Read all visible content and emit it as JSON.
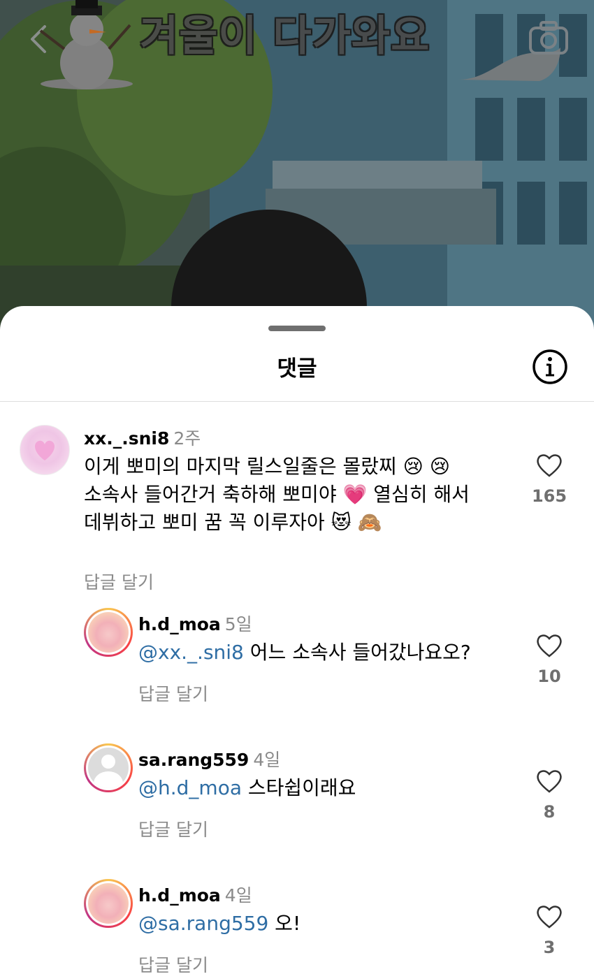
{
  "reel": {
    "overlay_text": "겨울이 다가와요",
    "icons": [
      "back-icon",
      "camera-icon",
      "snowman-sticker",
      "whale-sticker"
    ]
  },
  "sheet": {
    "title": "댓글",
    "info_icon": "info-icon"
  },
  "comments": [
    {
      "username": "xx._.sni8",
      "time": "2주",
      "lines": [
        "이게 뽀미의 마지막 릴스일줄은 몰랐찌 😢 😢",
        "소속사 들어간거 축하해 뽀미야 💗 열심히 해서",
        "데뷔하고 뽀미 꿈 꼭 이루자아 😻 🙈"
      ],
      "reply_label": "답글 달기",
      "likes": "165"
    },
    {
      "username": "h.d_moa",
      "time": "5일",
      "mention": "@xx._.sni8",
      "text": " 어느 소속사 들어갔나요오?",
      "reply_label": "답글 달기",
      "likes": "10"
    },
    {
      "username": "sa.rang559",
      "time": "4일",
      "mention": "@h.d_moa",
      "text": " 스타쉽이래요",
      "reply_label": "답글 달기",
      "likes": "8"
    },
    {
      "username": "h.d_moa",
      "time": "4일",
      "mention": "@sa.rang559",
      "text": " 오!",
      "reply_label": "답글 달기",
      "likes": "3"
    }
  ],
  "colors": {
    "mention": "#2e6da4",
    "muted": "#8a8a8a"
  }
}
